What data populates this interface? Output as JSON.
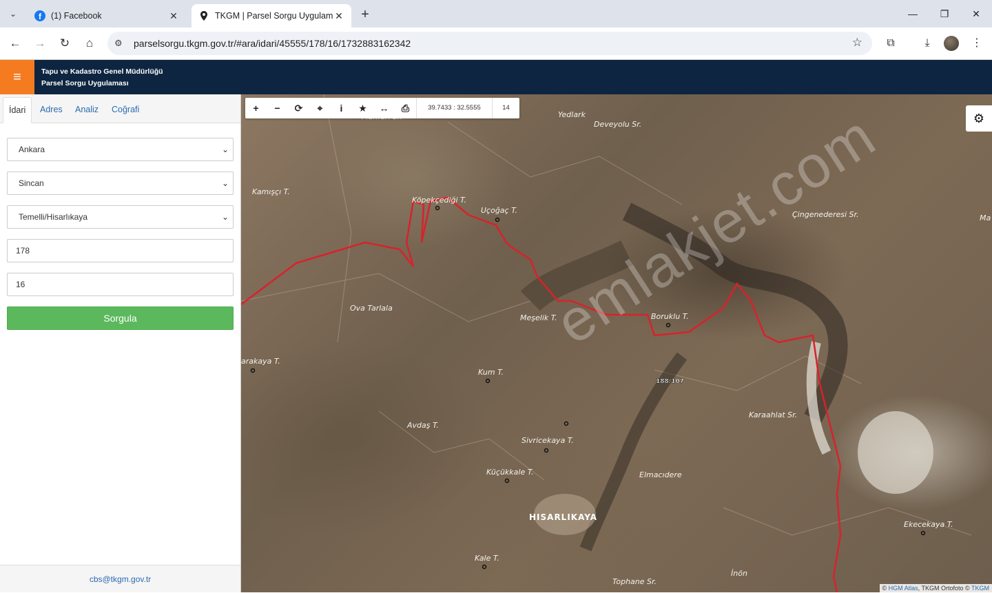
{
  "browser": {
    "tabs": [
      {
        "title": "(1) Facebook",
        "icon": "facebook-icon"
      },
      {
        "title": "TKGM | Parsel Sorgu Uygulaması",
        "icon": "location-pin-icon"
      }
    ],
    "url": "parselsorgu.tkgm.gov.tr/#ara/idari/45555/178/16/1732883162342"
  },
  "app": {
    "title_line1": "Tapu ve Kadastro Genel Müdürlüğü",
    "title_line2": "Parsel Sorgu Uygulaması",
    "accent": "#f47b20",
    "header_bg": "#0d2540"
  },
  "sidebar": {
    "tabs": [
      "İdari",
      "Adres",
      "Analiz",
      "Coğrafi"
    ],
    "active_tab": "İdari",
    "province": "Ankara",
    "district": "Sincan",
    "neighborhood": "Temelli/Hisarlıkaya",
    "block": "178",
    "parcel": "16",
    "submit_label": "Sorgula",
    "footer_email": "cbs@tkgm.gov.tr",
    "submit_color": "#5cb85c"
  },
  "map": {
    "coordinates": "39.7433 : 32.5555",
    "zoom": "14",
    "parcel_label": "188/107",
    "watermark": "emlakjet.com",
    "attribution": {
      "prefix": "© ",
      "link1": "HGM Atlas",
      "middle": ", TKGM Ortofoto © ",
      "link2": "TKGM"
    },
    "places": [
      {
        "name": "Yedlark"
      },
      {
        "name": "Deveyolu Sr."
      },
      {
        "name": "Kamışçı T."
      },
      {
        "name": "Köpekçediği T."
      },
      {
        "name": "Uçoğaç T."
      },
      {
        "name": "Çingenederesi Sr."
      },
      {
        "name": "Ma"
      },
      {
        "name": "Ova Tarlala"
      },
      {
        "name": "Meşelik T."
      },
      {
        "name": "Boruklu T."
      },
      {
        "name": "arakaya T."
      },
      {
        "name": "Kum T."
      },
      {
        "name": "Karaahlat Sr."
      },
      {
        "name": "Avdaş T."
      },
      {
        "name": "Sivricekaya T."
      },
      {
        "name": "Küçükkale T."
      },
      {
        "name": "Elmacıdere"
      },
      {
        "name": "HISARLIKAYA"
      },
      {
        "name": "Ekecekaya T."
      },
      {
        "name": "Kale T."
      },
      {
        "name": "İnön"
      },
      {
        "name": "Tophane Sr."
      },
      {
        "name": "Mahfurl Sr."
      }
    ]
  }
}
